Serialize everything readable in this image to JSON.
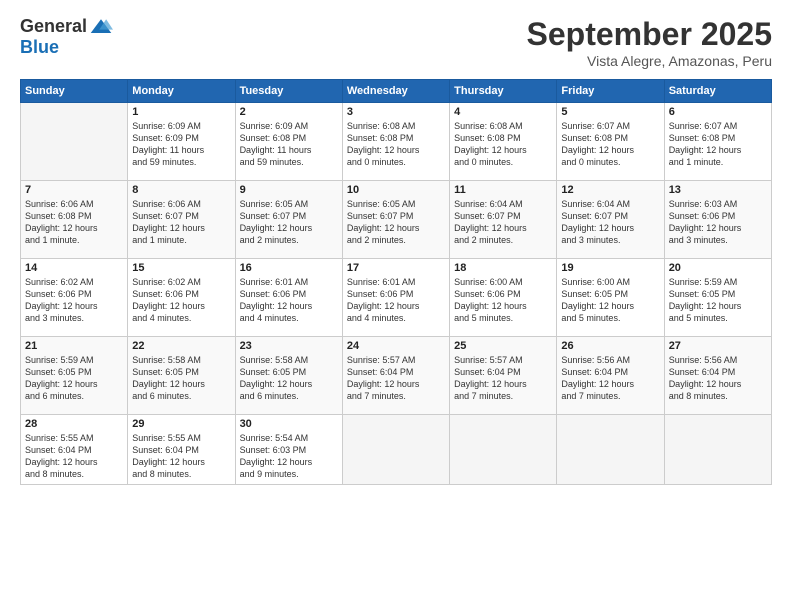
{
  "header": {
    "logo_general": "General",
    "logo_blue": "Blue",
    "month_year": "September 2025",
    "location": "Vista Alegre, Amazonas, Peru"
  },
  "days_of_week": [
    "Sunday",
    "Monday",
    "Tuesday",
    "Wednesday",
    "Thursday",
    "Friday",
    "Saturday"
  ],
  "weeks": [
    [
      {
        "day": "",
        "info": ""
      },
      {
        "day": "1",
        "info": "Sunrise: 6:09 AM\nSunset: 6:09 PM\nDaylight: 11 hours\nand 59 minutes."
      },
      {
        "day": "2",
        "info": "Sunrise: 6:09 AM\nSunset: 6:08 PM\nDaylight: 11 hours\nand 59 minutes."
      },
      {
        "day": "3",
        "info": "Sunrise: 6:08 AM\nSunset: 6:08 PM\nDaylight: 12 hours\nand 0 minutes."
      },
      {
        "day": "4",
        "info": "Sunrise: 6:08 AM\nSunset: 6:08 PM\nDaylight: 12 hours\nand 0 minutes."
      },
      {
        "day": "5",
        "info": "Sunrise: 6:07 AM\nSunset: 6:08 PM\nDaylight: 12 hours\nand 0 minutes."
      },
      {
        "day": "6",
        "info": "Sunrise: 6:07 AM\nSunset: 6:08 PM\nDaylight: 12 hours\nand 1 minute."
      }
    ],
    [
      {
        "day": "7",
        "info": "Sunrise: 6:06 AM\nSunset: 6:08 PM\nDaylight: 12 hours\nand 1 minute."
      },
      {
        "day": "8",
        "info": "Sunrise: 6:06 AM\nSunset: 6:07 PM\nDaylight: 12 hours\nand 1 minute."
      },
      {
        "day": "9",
        "info": "Sunrise: 6:05 AM\nSunset: 6:07 PM\nDaylight: 12 hours\nand 2 minutes."
      },
      {
        "day": "10",
        "info": "Sunrise: 6:05 AM\nSunset: 6:07 PM\nDaylight: 12 hours\nand 2 minutes."
      },
      {
        "day": "11",
        "info": "Sunrise: 6:04 AM\nSunset: 6:07 PM\nDaylight: 12 hours\nand 2 minutes."
      },
      {
        "day": "12",
        "info": "Sunrise: 6:04 AM\nSunset: 6:07 PM\nDaylight: 12 hours\nand 3 minutes."
      },
      {
        "day": "13",
        "info": "Sunrise: 6:03 AM\nSunset: 6:06 PM\nDaylight: 12 hours\nand 3 minutes."
      }
    ],
    [
      {
        "day": "14",
        "info": "Sunrise: 6:02 AM\nSunset: 6:06 PM\nDaylight: 12 hours\nand 3 minutes."
      },
      {
        "day": "15",
        "info": "Sunrise: 6:02 AM\nSunset: 6:06 PM\nDaylight: 12 hours\nand 4 minutes."
      },
      {
        "day": "16",
        "info": "Sunrise: 6:01 AM\nSunset: 6:06 PM\nDaylight: 12 hours\nand 4 minutes."
      },
      {
        "day": "17",
        "info": "Sunrise: 6:01 AM\nSunset: 6:06 PM\nDaylight: 12 hours\nand 4 minutes."
      },
      {
        "day": "18",
        "info": "Sunrise: 6:00 AM\nSunset: 6:06 PM\nDaylight: 12 hours\nand 5 minutes."
      },
      {
        "day": "19",
        "info": "Sunrise: 6:00 AM\nSunset: 6:05 PM\nDaylight: 12 hours\nand 5 minutes."
      },
      {
        "day": "20",
        "info": "Sunrise: 5:59 AM\nSunset: 6:05 PM\nDaylight: 12 hours\nand 5 minutes."
      }
    ],
    [
      {
        "day": "21",
        "info": "Sunrise: 5:59 AM\nSunset: 6:05 PM\nDaylight: 12 hours\nand 6 minutes."
      },
      {
        "day": "22",
        "info": "Sunrise: 5:58 AM\nSunset: 6:05 PM\nDaylight: 12 hours\nand 6 minutes."
      },
      {
        "day": "23",
        "info": "Sunrise: 5:58 AM\nSunset: 6:05 PM\nDaylight: 12 hours\nand 6 minutes."
      },
      {
        "day": "24",
        "info": "Sunrise: 5:57 AM\nSunset: 6:04 PM\nDaylight: 12 hours\nand 7 minutes."
      },
      {
        "day": "25",
        "info": "Sunrise: 5:57 AM\nSunset: 6:04 PM\nDaylight: 12 hours\nand 7 minutes."
      },
      {
        "day": "26",
        "info": "Sunrise: 5:56 AM\nSunset: 6:04 PM\nDaylight: 12 hours\nand 7 minutes."
      },
      {
        "day": "27",
        "info": "Sunrise: 5:56 AM\nSunset: 6:04 PM\nDaylight: 12 hours\nand 8 minutes."
      }
    ],
    [
      {
        "day": "28",
        "info": "Sunrise: 5:55 AM\nSunset: 6:04 PM\nDaylight: 12 hours\nand 8 minutes."
      },
      {
        "day": "29",
        "info": "Sunrise: 5:55 AM\nSunset: 6:04 PM\nDaylight: 12 hours\nand 8 minutes."
      },
      {
        "day": "30",
        "info": "Sunrise: 5:54 AM\nSunset: 6:03 PM\nDaylight: 12 hours\nand 9 minutes."
      },
      {
        "day": "",
        "info": ""
      },
      {
        "day": "",
        "info": ""
      },
      {
        "day": "",
        "info": ""
      },
      {
        "day": "",
        "info": ""
      }
    ]
  ]
}
